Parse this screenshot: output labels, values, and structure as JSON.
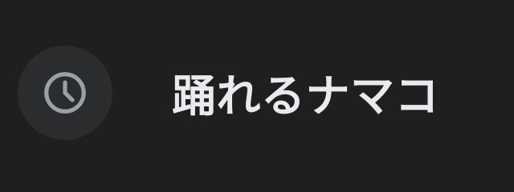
{
  "history_item": {
    "icon": "clock-icon",
    "label": "踊れるナマコ"
  },
  "colors": {
    "background": "#1f1f1f",
    "icon_circle": "#2b2c2e",
    "icon_stroke": "#9aa0a6",
    "text": "#e8eaed"
  }
}
